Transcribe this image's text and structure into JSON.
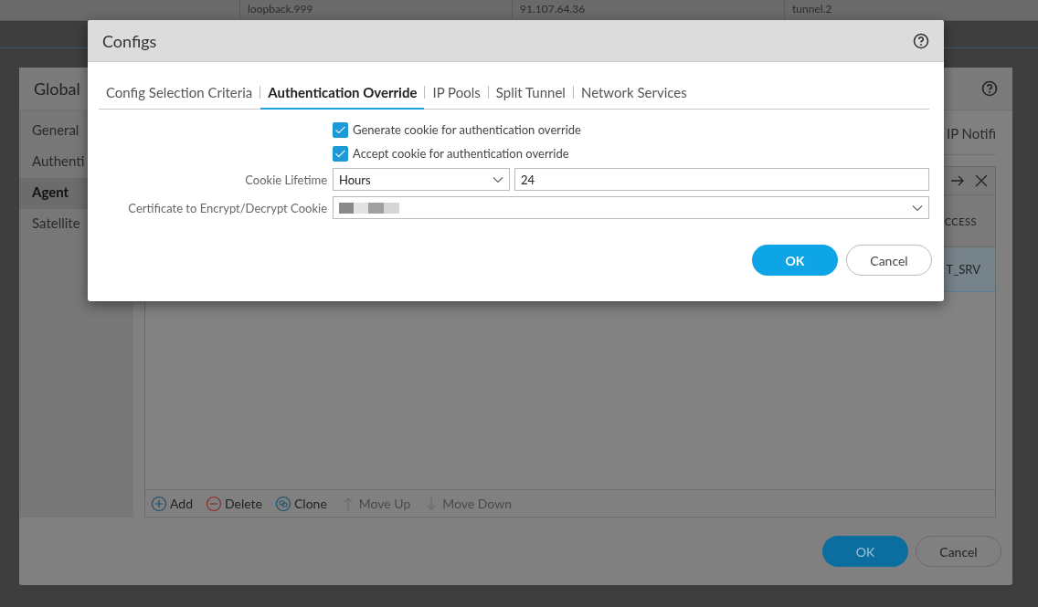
{
  "background_table": {
    "cells": [
      "loopback.999",
      "91.107.64.36",
      "tunnel.2"
    ]
  },
  "global_dialog": {
    "title": "Global",
    "sidebar": {
      "items": [
        {
          "label": "General",
          "selected": false
        },
        {
          "label": "Authenti",
          "selected": false
        },
        {
          "label": "Agent",
          "selected": true
        },
        {
          "label": "Satellite",
          "selected": false
        }
      ]
    },
    "tab_label": "IP Notifi",
    "table": {
      "columns": [
        "CCESS"
      ],
      "rows": [
        {
          "cells": [
            "T_SRV"
          ],
          "selected": true
        }
      ]
    },
    "actions": [
      {
        "label": "Add",
        "kind": "add",
        "disabled": false
      },
      {
        "label": "Delete",
        "kind": "delete",
        "disabled": false
      },
      {
        "label": "Clone",
        "kind": "clone",
        "disabled": false
      },
      {
        "label": "Move Up",
        "kind": "up",
        "disabled": true
      },
      {
        "label": "Move Down",
        "kind": "down",
        "disabled": true
      }
    ],
    "buttons": [
      {
        "label": "OK",
        "kind": "primary"
      },
      {
        "label": "Cancel",
        "kind": "secondary"
      }
    ]
  },
  "configs_dialog": {
    "title": "Configs",
    "tabs": [
      {
        "label": "Config Selection Criteria",
        "selected": false
      },
      {
        "label": "Authentication Override",
        "selected": true
      },
      {
        "label": "IP Pools",
        "selected": false
      },
      {
        "label": "Split Tunnel",
        "selected": false
      },
      {
        "label": "Network Services",
        "selected": false
      }
    ],
    "checkboxes": [
      {
        "label": "Generate cookie for authentication override",
        "checked": true
      },
      {
        "label": "Accept cookie for authentication override",
        "checked": true
      }
    ],
    "cookie_lifetime": {
      "label": "Cookie Lifetime",
      "unit": "Hours",
      "value": "24"
    },
    "certificate": {
      "label": "Certificate to Encrypt/Decrypt Cookie"
    },
    "buttons": [
      {
        "label": "OK",
        "kind": "primary"
      },
      {
        "label": "Cancel",
        "kind": "secondary"
      }
    ]
  }
}
